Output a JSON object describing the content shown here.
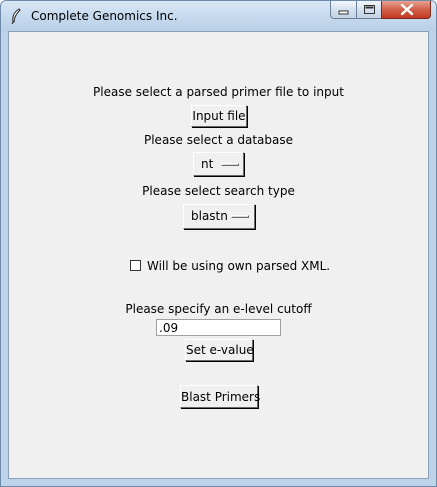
{
  "window": {
    "title": "Complete Genomics Inc."
  },
  "controls": {
    "minimize": "minimize",
    "maximize": "maximize",
    "close": "close"
  },
  "form": {
    "input_prompt": "Please select a parsed primer file to input",
    "input_button": "Input file",
    "database_prompt": "Please select a database",
    "database_value": "nt",
    "search_prompt": "Please select search type",
    "search_value": "blastn",
    "xml_checkbox_label": "Will be using own parsed XML.",
    "xml_checked": false,
    "evalue_prompt": "Please specify an e-level cutoff",
    "evalue_value": ".09",
    "evalue_button": "Set e-value",
    "blast_button": "Blast Primers"
  },
  "colors": {
    "client_bg": "#f0f0f0",
    "titlebar": "#c5d9ee",
    "close_button": "#c13a23"
  },
  "icons": {
    "app_icon": "feather-icon",
    "minimize_icon": "minimize-icon",
    "maximize_icon": "maximize-icon",
    "close_icon": "close-icon"
  }
}
